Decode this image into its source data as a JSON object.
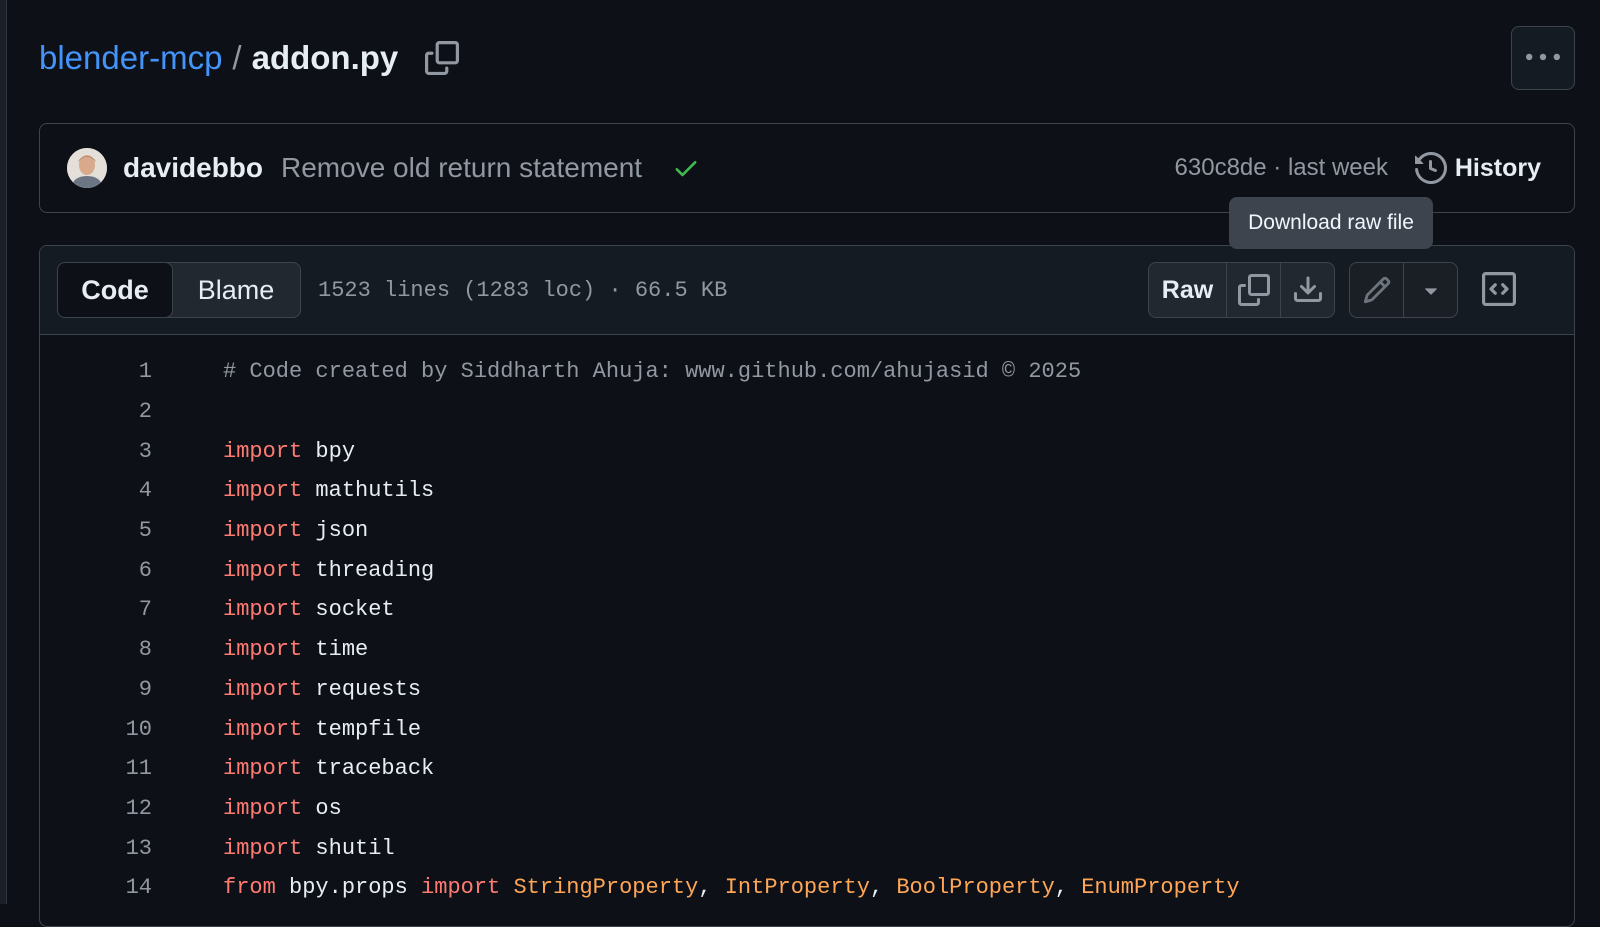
{
  "breadcrumb": {
    "repo": "blender-mcp",
    "separator": "/",
    "file": "addon.py"
  },
  "commit": {
    "author": "davidebbo",
    "message": "Remove old return statement",
    "status": "success",
    "meta": "630c8de · last week",
    "history_label": "History"
  },
  "tooltip": "Download raw file",
  "toolbar": {
    "code_tab": "Code",
    "blame_tab": "Blame",
    "file_info": "1523 lines (1283 loc) · 66.5 KB",
    "raw_label": "Raw"
  },
  "icons": {
    "copy_path": "copy-icon",
    "more": "kebab-horizontal-icon",
    "history": "history-icon",
    "check": "check-icon",
    "copy_raw": "copy-icon",
    "download": "download-icon",
    "edit": "pencil-icon",
    "dropdown": "triangle-down-icon",
    "symbols": "code-square-icon"
  },
  "colors": {
    "background": "#0d1117",
    "link": "#4493f8",
    "keyword": "#ff7b72",
    "class_name": "#ffa657",
    "comment": "#9198a1",
    "success": "#3fb950"
  },
  "code_lines": [
    {
      "n": "1",
      "tokens": [
        {
          "t": "comment",
          "v": "# Code created by Siddharth Ahuja: www.github.com/ahujasid © 2025"
        }
      ]
    },
    {
      "n": "2",
      "tokens": []
    },
    {
      "n": "3",
      "tokens": [
        {
          "t": "kw",
          "v": "import"
        },
        {
          "t": "plain",
          "v": " bpy"
        }
      ]
    },
    {
      "n": "4",
      "tokens": [
        {
          "t": "kw",
          "v": "import"
        },
        {
          "t": "plain",
          "v": " mathutils"
        }
      ]
    },
    {
      "n": "5",
      "tokens": [
        {
          "t": "kw",
          "v": "import"
        },
        {
          "t": "plain",
          "v": " json"
        }
      ]
    },
    {
      "n": "6",
      "tokens": [
        {
          "t": "kw",
          "v": "import"
        },
        {
          "t": "plain",
          "v": " threading"
        }
      ]
    },
    {
      "n": "7",
      "tokens": [
        {
          "t": "kw",
          "v": "import"
        },
        {
          "t": "plain",
          "v": " socket"
        }
      ]
    },
    {
      "n": "8",
      "tokens": [
        {
          "t": "kw",
          "v": "import"
        },
        {
          "t": "plain",
          "v": " time"
        }
      ]
    },
    {
      "n": "9",
      "tokens": [
        {
          "t": "kw",
          "v": "import"
        },
        {
          "t": "plain",
          "v": " requests"
        }
      ]
    },
    {
      "n": "10",
      "tokens": [
        {
          "t": "kw",
          "v": "import"
        },
        {
          "t": "plain",
          "v": " tempfile"
        }
      ]
    },
    {
      "n": "11",
      "tokens": [
        {
          "t": "kw",
          "v": "import"
        },
        {
          "t": "plain",
          "v": " traceback"
        }
      ]
    },
    {
      "n": "12",
      "tokens": [
        {
          "t": "kw",
          "v": "import"
        },
        {
          "t": "plain",
          "v": " os"
        }
      ]
    },
    {
      "n": "13",
      "tokens": [
        {
          "t": "kw",
          "v": "import"
        },
        {
          "t": "plain",
          "v": " shutil"
        }
      ]
    },
    {
      "n": "14",
      "tokens": [
        {
          "t": "kw",
          "v": "from"
        },
        {
          "t": "plain",
          "v": " bpy.props "
        },
        {
          "t": "kw",
          "v": "import"
        },
        {
          "t": "plain",
          "v": " "
        },
        {
          "t": "cls",
          "v": "StringProperty"
        },
        {
          "t": "plain",
          "v": ", "
        },
        {
          "t": "cls",
          "v": "IntProperty"
        },
        {
          "t": "plain",
          "v": ", "
        },
        {
          "t": "cls",
          "v": "BoolProperty"
        },
        {
          "t": "plain",
          "v": ", "
        },
        {
          "t": "cls",
          "v": "EnumProperty"
        }
      ]
    }
  ]
}
